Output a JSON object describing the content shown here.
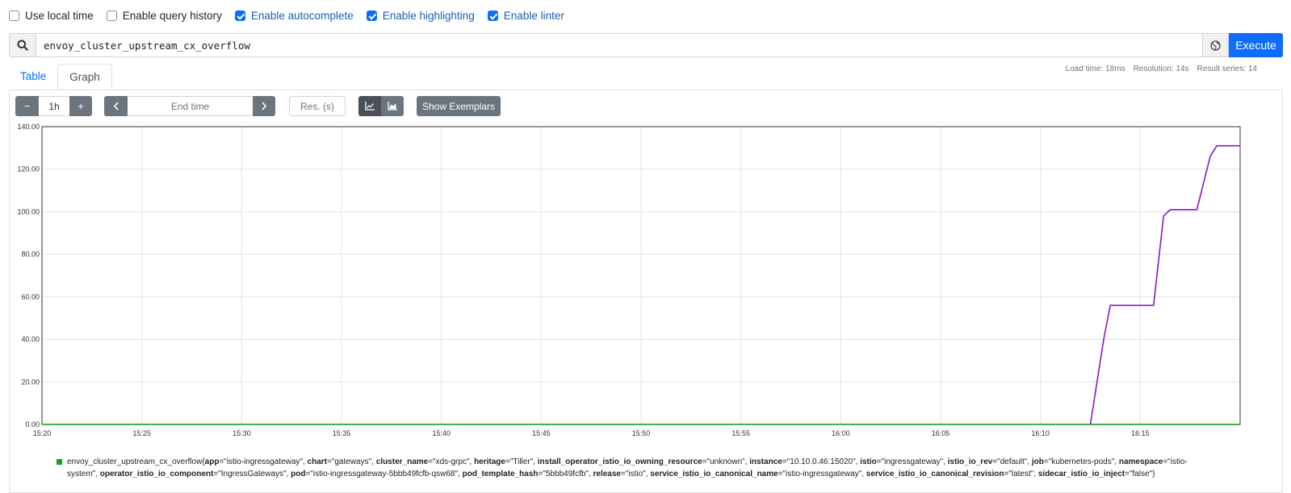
{
  "options": [
    {
      "label": "Use local time",
      "checked": false
    },
    {
      "label": "Enable query history",
      "checked": false
    },
    {
      "label": "Enable autocomplete",
      "checked": true
    },
    {
      "label": "Enable highlighting",
      "checked": true
    },
    {
      "label": "Enable linter",
      "checked": true
    }
  ],
  "query": {
    "expression": "envoy_cluster_upstream_cx_overflow",
    "execute_label": "Execute"
  },
  "tabs": [
    {
      "label": "Table",
      "active": false
    },
    {
      "label": "Graph",
      "active": true
    }
  ],
  "stats": {
    "load_time": "Load time: 18ms",
    "resolution": "Resolution: 14s",
    "result_series": "Result series: 14"
  },
  "controls": {
    "range_minus": "−",
    "range_value": "1h",
    "range_plus": "+",
    "end_time_placeholder": "End time",
    "resolution_placeholder": "Res. (s)",
    "show_exemplars": "Show Exemplars"
  },
  "chart_data": {
    "type": "line",
    "title": "",
    "xlabel": "",
    "ylabel": "",
    "ylim": [
      0,
      140
    ],
    "grid": true,
    "x_ticks": [
      "15:20",
      "15:25",
      "15:30",
      "15:35",
      "15:40",
      "15:45",
      "15:50",
      "15:55",
      "16:00",
      "16:05",
      "16:10",
      "16:15"
    ],
    "y_ticks": [
      "0.00",
      "20.00",
      "40.00",
      "60.00",
      "80.00",
      "100.00",
      "120.00",
      "140.00"
    ],
    "x_range": [
      "15:20",
      "16:20"
    ],
    "series": [
      {
        "color": "#8a16c9",
        "points": [
          [
            "16:12:30",
            0
          ],
          [
            "16:13:10",
            40
          ],
          [
            "16:13:30",
            56
          ],
          [
            "16:15:40",
            56
          ],
          [
            "16:16:10",
            98
          ],
          [
            "16:16:30",
            101
          ],
          [
            "16:17:50",
            101
          ],
          [
            "16:18:30",
            126
          ],
          [
            "16:18:50",
            131
          ],
          [
            "16:20:00",
            131
          ]
        ]
      },
      {
        "color": "#12a11d",
        "points": [
          [
            "15:20:00",
            0
          ],
          [
            "16:20:00",
            0
          ]
        ]
      }
    ]
  },
  "legend": {
    "metric": "envoy_cluster_upstream_cx_overflow",
    "labels": [
      {
        "k": "app",
        "v": "\"istio-ingressgateway\""
      },
      {
        "k": "chart",
        "v": "\"gateways\""
      },
      {
        "k": "cluster_name",
        "v": "\"xds-grpc\""
      },
      {
        "k": "heritage",
        "v": "\"Tiller\""
      },
      {
        "k": "install_operator_istio_io_owning_resource",
        "v": "\"unknown\""
      },
      {
        "k": "instance",
        "v": "\"10.10.0.46:15020\""
      },
      {
        "k": "istio",
        "v": "\"ingressgateway\""
      },
      {
        "k": "istio_io_rev",
        "v": "\"default\""
      },
      {
        "k": "job",
        "v": "\"kubernetes-pods\""
      },
      {
        "k": "namespace",
        "v": "\"istio-system\""
      },
      {
        "k": "operator_istio_io_component",
        "v": "\"IngressGateways\""
      },
      {
        "k": "pod",
        "v": "\"istio-ingressgateway-5bbb49fcfb-qsw68\""
      },
      {
        "k": "pod_template_hash",
        "v": "\"5bbb49fcfb\""
      },
      {
        "k": "release",
        "v": "\"istio\""
      },
      {
        "k": "service_istio_io_canonical_name",
        "v": "\"istio-ingressgateway\""
      },
      {
        "k": "service_istio_io_canonical_revision",
        "v": "\"latest\""
      },
      {
        "k": "sidecar_istio_io_inject",
        "v": "\"false\""
      }
    ]
  }
}
